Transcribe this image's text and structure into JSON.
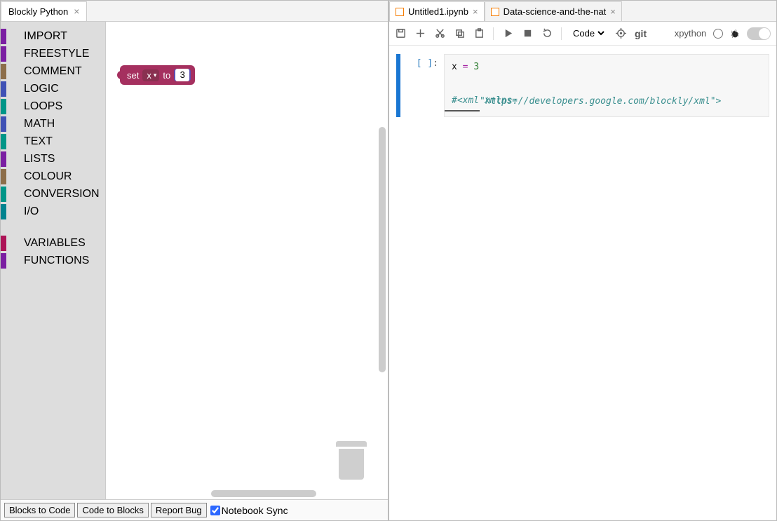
{
  "left": {
    "tab_title": "Blockly Python",
    "toolbox_main": [
      {
        "label": "IMPORT",
        "color": "#7b1fa2"
      },
      {
        "label": "FREESTYLE",
        "color": "#7b1fa2"
      },
      {
        "label": "COMMENT",
        "color": "#8d6e4a"
      },
      {
        "label": "LOGIC",
        "color": "#3f51b5"
      },
      {
        "label": "LOOPS",
        "color": "#009688"
      },
      {
        "label": "MATH",
        "color": "#3f51b5"
      },
      {
        "label": "TEXT",
        "color": "#009688"
      },
      {
        "label": "LISTS",
        "color": "#7b1fa2"
      },
      {
        "label": "COLOUR",
        "color": "#8d6e4a"
      },
      {
        "label": "CONVERSION",
        "color": "#009688"
      },
      {
        "label": "I/O",
        "color": "#00838f"
      }
    ],
    "toolbox_extra": [
      {
        "label": "VARIABLES",
        "color": "#ad1457"
      },
      {
        "label": "FUNCTIONS",
        "color": "#7b1fa2"
      }
    ],
    "block": {
      "set_label": "set",
      "var_name": "x",
      "to_label": "to",
      "value": "3"
    },
    "buttons": {
      "blocks_to_code": "Blocks to Code",
      "code_to_blocks": "Code to Blocks",
      "report_bug": "Report Bug",
      "notebook_sync": "Notebook Sync"
    }
  },
  "right": {
    "tabs": [
      {
        "label": "Untitled1.ipynb",
        "active": true
      },
      {
        "label": "Data-science-and-the-nat",
        "active": false
      }
    ],
    "toolbar": {
      "cell_type": "Code",
      "git_label": "git",
      "kernel_name": "xpython"
    },
    "cell": {
      "prompt": "[ ]:",
      "line1": {
        "var": "x",
        "op": "=",
        "num": "3"
      },
      "line2_comment_prefix": "#<xml xmlns=",
      "line2_url": "\"https://developers.google.com/blockly/xml\"",
      "line2_suffix": ">"
    }
  }
}
